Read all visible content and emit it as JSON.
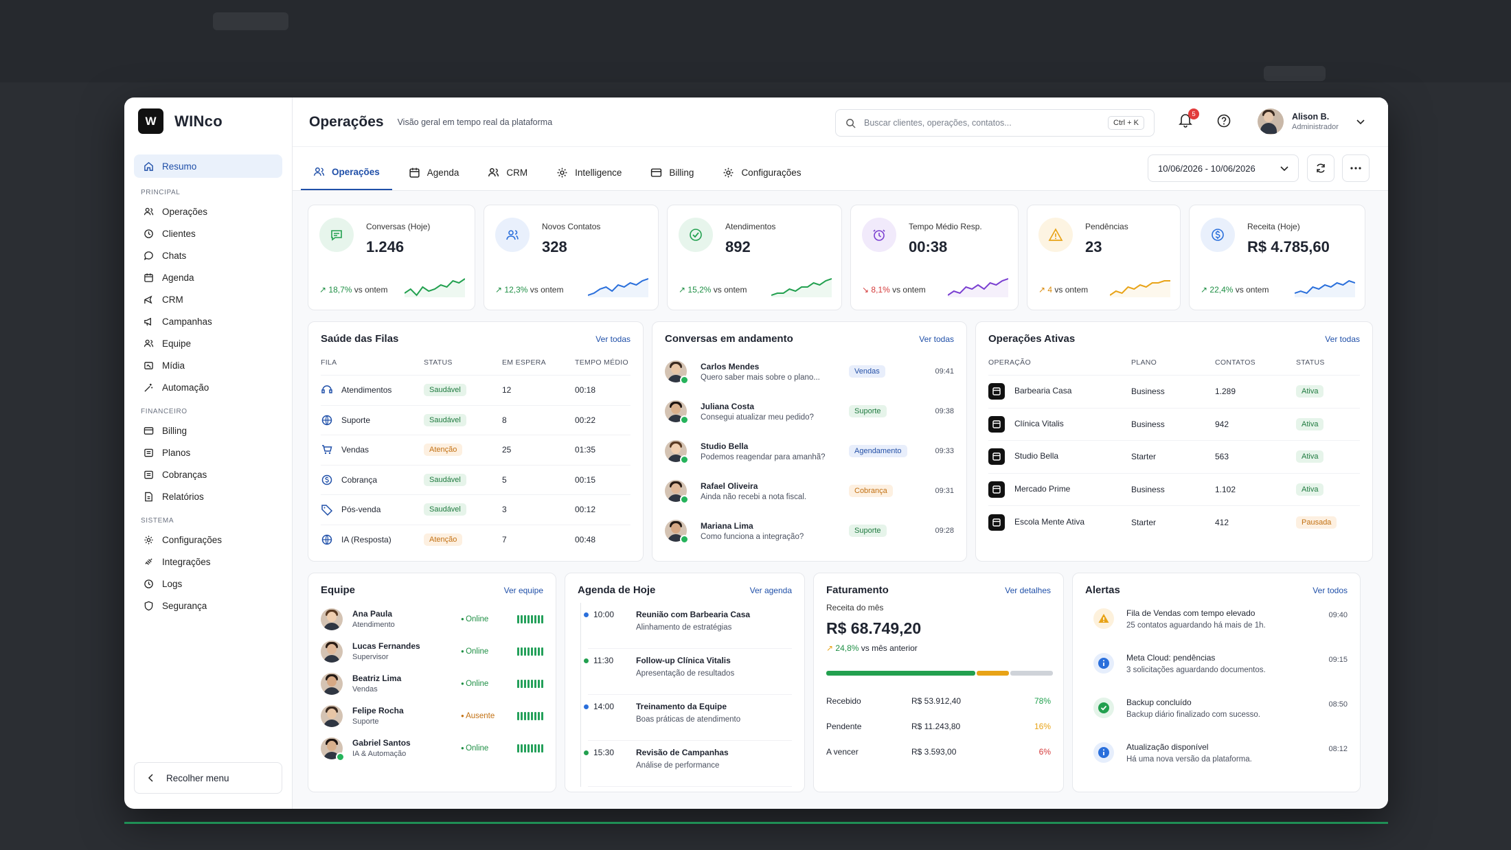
{
  "app": {
    "logo_letter": "W",
    "name": "WINco"
  },
  "sidebar": {
    "active": "Resumo",
    "sections": [
      {
        "title": "PRINCIPAL",
        "items": [
          "Operações",
          "Clientes",
          "Chats",
          "Agenda",
          "CRM",
          "Campanhas",
          "Equipe",
          "Mídia",
          "Automação"
        ]
      },
      {
        "title": "FINANCEIRO",
        "items": [
          "Billing",
          "Planos",
          "Cobranças",
          "Relatórios"
        ]
      },
      {
        "title": "SISTEMA",
        "items": [
          "Configurações",
          "Integrações",
          "Logs",
          "Segurança"
        ]
      }
    ],
    "collapse": "Recolher menu"
  },
  "header": {
    "title": "Operações",
    "subtitle": "Visão geral em tempo real da plataforma",
    "search_placeholder": "Buscar clientes, operações, contatos...",
    "shortcut": "Ctrl + K",
    "notifications": "5",
    "user_name": "Alison B.",
    "user_role": "Administrador"
  },
  "tabs": [
    "Operações",
    "Agenda",
    "CRM",
    "Intelligence",
    "Billing",
    "Configurações"
  ],
  "date_range": "10/06/2026 - 10/06/2026",
  "kpis": [
    {
      "label": "Conversas (Hoje)",
      "value": "1.246",
      "change": "18,7%",
      "suffix": "vs ontem",
      "color": "#22a04f",
      "bg": "#e7f5ec",
      "dir": "up"
    },
    {
      "label": "Novos Contatos",
      "value": "328",
      "change": "12,3%",
      "suffix": "vs ontem",
      "color": "#2a6fdb",
      "bg": "#e9f0fc",
      "dir": "up"
    },
    {
      "label": "Atendimentos",
      "value": "892",
      "change": "15,2%",
      "suffix": "vs ontem",
      "color": "#22a04f",
      "bg": "#e7f5ec",
      "dir": "up"
    },
    {
      "label": "Tempo Médio Resp.",
      "value": "00:38",
      "change": "8,1%",
      "suffix": "vs ontem",
      "color": "#7a3fd1",
      "bg": "#f1eafb",
      "dir": "down"
    },
    {
      "label": "Pendências",
      "value": "23",
      "change": "4",
      "suffix": "vs ontem",
      "color": "#e8a317",
      "bg": "#fdf4e2",
      "dir": "warn"
    },
    {
      "label": "Receita (Hoje)",
      "value": "R$ 4.785,60",
      "change": "22,4%",
      "suffix": "vs ontem",
      "color": "#2a6fdb",
      "bg": "#e9f0fc",
      "dir": "up"
    }
  ],
  "queues": {
    "title": "Saúde das Filas",
    "link": "Ver todas",
    "headers": [
      "FILA",
      "STATUS",
      "EM ESPERA",
      "TEMPO MÉDIO"
    ],
    "rows": [
      [
        "Atendimentos",
        "Saudável",
        "12",
        "00:18"
      ],
      [
        "Suporte",
        "Saudável",
        "8",
        "00:22"
      ],
      [
        "Vendas",
        "Atenção",
        "25",
        "01:35"
      ],
      [
        "Cobrança",
        "Saudável",
        "5",
        "00:15"
      ],
      [
        "Pós-venda",
        "Saudável",
        "3",
        "00:12"
      ],
      [
        "IA (Resposta)",
        "Atenção",
        "7",
        "00:48"
      ]
    ]
  },
  "conversations": {
    "title": "Conversas em andamento",
    "link": "Ver todas",
    "rows": [
      {
        "name": "Carlos Mendes",
        "msg": "Quero saber mais sobre o plano...",
        "tag": "Vendas",
        "time": "09:41"
      },
      {
        "name": "Juliana Costa",
        "msg": "Consegui atualizar meu pedido?",
        "tag": "Suporte",
        "time": "09:38"
      },
      {
        "name": "Studio Bella",
        "msg": "Podemos reagendar para amanhã?",
        "tag": "Agendamento",
        "time": "09:33"
      },
      {
        "name": "Rafael Oliveira",
        "msg": "Ainda não recebi a nota fiscal.",
        "tag": "Cobrança",
        "time": "09:31"
      },
      {
        "name": "Mariana Lima",
        "msg": "Como funciona a integração?",
        "tag": "Suporte",
        "time": "09:28"
      }
    ]
  },
  "operations": {
    "title": "Operações Ativas",
    "link": "Ver todas",
    "headers": [
      "OPERAÇÃO",
      "PLANO",
      "CONTATOS",
      "STATUS"
    ],
    "rows": [
      [
        "Barbearia Casa",
        "Business",
        "1.289",
        "Ativa"
      ],
      [
        "Clínica Vitalis",
        "Business",
        "942",
        "Ativa"
      ],
      [
        "Studio Bella",
        "Starter",
        "563",
        "Ativa"
      ],
      [
        "Mercado Prime",
        "Business",
        "1.102",
        "Ativa"
      ],
      [
        "Escola Mente Ativa",
        "Starter",
        "412",
        "Pausada"
      ]
    ]
  },
  "team": {
    "title": "Equipe",
    "link": "Ver equipe",
    "rows": [
      {
        "name": "Ana Paula",
        "role": "Atendimento",
        "status": "Online"
      },
      {
        "name": "Lucas Fernandes",
        "role": "Supervisor",
        "status": "Online"
      },
      {
        "name": "Beatriz Lima",
        "role": "Vendas",
        "status": "Online"
      },
      {
        "name": "Felipe Rocha",
        "role": "Suporte",
        "status": "Ausente"
      },
      {
        "name": "Gabriel Santos",
        "role": "IA & Automação",
        "status": "Online"
      }
    ]
  },
  "agenda": {
    "title": "Agenda de Hoje",
    "link": "Ver agenda",
    "rows": [
      {
        "time": "10:00",
        "title": "Reunião com Barbearia Casa",
        "sub": "Alinhamento de estratégias",
        "color": "#2a6fdb"
      },
      {
        "time": "11:30",
        "title": "Follow-up Clínica Vitalis",
        "sub": "Apresentação de resultados",
        "color": "#22a04f"
      },
      {
        "time": "14:00",
        "title": "Treinamento da Equipe",
        "sub": "Boas práticas de atendimento",
        "color": "#2a6fdb"
      },
      {
        "time": "15:30",
        "title": "Revisão de Campanhas",
        "sub": "Análise de performance",
        "color": "#22a04f"
      }
    ]
  },
  "billing": {
    "title": "Faturamento",
    "link": "Ver detalhes",
    "label": "Receita do mês",
    "value": "R$ 68.749,20",
    "change": "24,8%",
    "change_suffix": "vs mês anterior",
    "progress": {
      "green": 0.7,
      "orange": 0.15,
      "gray": 0.2
    },
    "rows": [
      [
        "Recebido",
        "R$ 53.912,40",
        "78%",
        "#22a04f"
      ],
      [
        "Pendente",
        "R$ 11.243,80",
        "16%",
        "#e8a317"
      ],
      [
        "A vencer",
        "R$ 3.593,00",
        "6%",
        "#d43a3a"
      ]
    ]
  },
  "alerts": {
    "title": "Alertas",
    "link": "Ver todos",
    "rows": [
      {
        "title": "Fila de Vendas com tempo elevado",
        "sub": "25 contatos aguardando há mais de 1h.",
        "time": "09:40",
        "type": "warn"
      },
      {
        "title": "Meta Cloud: pendências",
        "sub": "3 solicitações aguardando documentos.",
        "time": "09:15",
        "type": "info"
      },
      {
        "title": "Backup concluído",
        "sub": "Backup diário finalizado com sucesso.",
        "time": "08:50",
        "type": "ok"
      },
      {
        "title": "Atualização disponível",
        "sub": "Há uma nova versão da plataforma.",
        "time": "08:12",
        "type": "info"
      }
    ]
  }
}
